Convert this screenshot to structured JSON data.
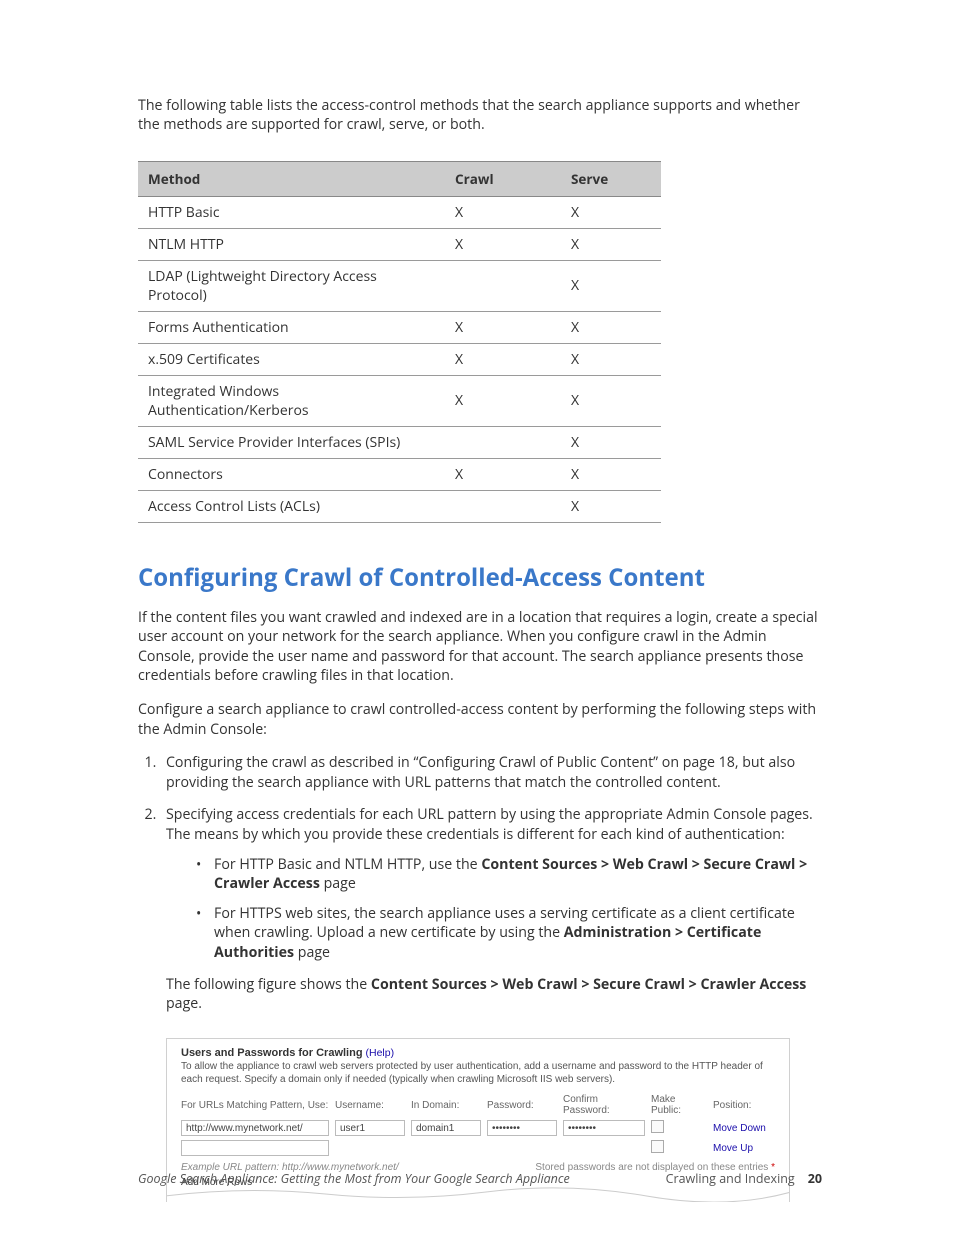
{
  "intro": "The following table lists the access-control methods that the search appliance supports and whether the methods are supported for crawl, serve, or both.",
  "table": {
    "headers": {
      "method": "Method",
      "crawl": "Crawl",
      "serve": "Serve"
    },
    "rows": [
      {
        "method": "HTTP Basic",
        "crawl": "X",
        "serve": "X"
      },
      {
        "method": "NTLM HTTP",
        "crawl": "X",
        "serve": "X"
      },
      {
        "method": "LDAP (Lightweight Directory Access Protocol)",
        "crawl": "",
        "serve": "X"
      },
      {
        "method": "Forms Authentication",
        "crawl": "X",
        "serve": "X"
      },
      {
        "method": "x.509 Certificates",
        "crawl": "X",
        "serve": "X"
      },
      {
        "method": "Integrated Windows Authentication/Kerberos",
        "crawl": "X",
        "serve": "X"
      },
      {
        "method": "SAML Service Provider Interfaces (SPIs)",
        "crawl": "",
        "serve": "X"
      },
      {
        "method": "Connectors",
        "crawl": "X",
        "serve": "X"
      },
      {
        "method": "Access Control Lists (ACLs)",
        "crawl": "",
        "serve": "X"
      }
    ]
  },
  "heading": "Configuring Crawl of Controlled-Access Content",
  "p1": "If the content files you want crawled and indexed are in a location that requires a login, create a special user account on your network for the search appliance. When you configure crawl in the Admin Console, provide the user name and password for that account. The search appliance presents those credentials before crawling files in that location.",
  "p2": "Configure a search appliance to crawl controlled-access content by performing the following steps with the Admin Console:",
  "step1": "Configuring the crawl as described in “Configuring Crawl of Public Content” on page 18, but also providing the search appliance with URL patterns that match the controlled content.",
  "step2": "Specifying access credentials for each URL pattern by using the appropriate Admin Console pages. The means by which you provide these credentials is different for each kind of authentication:",
  "sub1a": "For HTTP Basic and NTLM HTTP, use the ",
  "sub1b": "Content Sources > Web Crawl > Secure Crawl > Crawler Access",
  "sub1c": " page",
  "sub2a": "For HTTPS web sites, the search appliance uses a serving certificate as a client certificate when crawling. Upload a new certificate by using the ",
  "sub2b": "Administration > Certificate Authorities",
  "sub2c": " page",
  "after_a": "The following figure shows the ",
  "after_b": "Content Sources > Web Crawl > Secure Crawl > Crawler Access",
  "after_c": " page.",
  "figure": {
    "title": "Users and Passwords for Crawling",
    "help": "(Help)",
    "desc": "To allow the appliance to crawl web servers protected by user authentication, add a username and password to the HTTP header of each request. Specify a domain only if needed (typically when crawling Microsoft IIS web servers).",
    "hdr": {
      "url": "For URLs Matching Pattern, Use:",
      "user": "Username:",
      "dom": "In Domain:",
      "pwd": "Password:",
      "cpwd": "Confirm Password:",
      "pub": "Make Public:",
      "pos": "Position:"
    },
    "row": {
      "url": "http://www.mynetwork.net/",
      "user": "user1",
      "dom": "domain1",
      "pwd": "••••••••",
      "cpwd": "••••••••"
    },
    "movedown": "Move Down",
    "moveup": "Move Up",
    "example": "Example URL pattern: http://www.mynetwork.net/",
    "stored": "Stored passwords are not displayed on these entries ",
    "star": "*",
    "addmore": "Add More Rows"
  },
  "footer": {
    "left": "Google Search Appliance: Getting the Most from Your Google Search Appliance",
    "right": "Crawling and Indexing",
    "page": "20"
  }
}
